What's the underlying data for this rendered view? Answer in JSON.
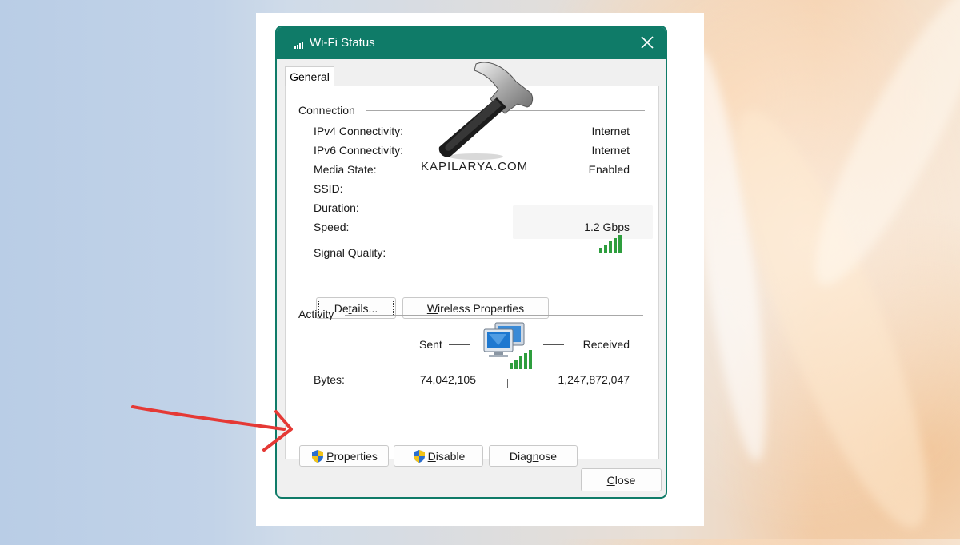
{
  "window": {
    "title": "Wi-Fi Status",
    "close_icon": "close-icon"
  },
  "tabs": [
    {
      "label": "General",
      "selected": true
    }
  ],
  "connection": {
    "heading": "Connection",
    "rows": [
      {
        "label": "IPv4 Connectivity:",
        "value": "Internet"
      },
      {
        "label": "IPv6 Connectivity:",
        "value": "Internet"
      },
      {
        "label": "Media State:",
        "value": "Enabled"
      },
      {
        "label": "SSID:",
        "value": ""
      },
      {
        "label": "Duration:",
        "value": ""
      },
      {
        "label": "Speed:",
        "value": "1.2 Gbps"
      }
    ],
    "signal_label": "Signal Quality:",
    "signal_bars_filled": 5,
    "signal_bars_total": 5,
    "details_button": {
      "prefix": "De",
      "accel": "t",
      "suffix": "ails..."
    },
    "wireless_properties_button": {
      "prefix": "",
      "accel": "W",
      "suffix": "ireless Properties"
    }
  },
  "activity": {
    "heading": "Activity",
    "sent_label": "Sent",
    "received_label": "Received",
    "bytes_label": "Bytes:",
    "bytes_sent": "74,042,105",
    "bytes_received": "1,247,872,047",
    "network_icon": "network-computers-icon"
  },
  "actions": {
    "properties": {
      "prefix": "",
      "accel": "P",
      "suffix": "roperties",
      "icon": "uac-shield-icon"
    },
    "disable": {
      "prefix": "",
      "accel": "D",
      "suffix": "isable",
      "icon": "uac-shield-icon"
    },
    "diagnose": {
      "prefix": "Diag",
      "accel": "n",
      "suffix": "ose"
    }
  },
  "footer": {
    "close": {
      "prefix": "",
      "accel": "C",
      "suffix": "lose"
    }
  },
  "watermark": {
    "text": "KAPILARYA.COM",
    "icon": "hammer-icon"
  },
  "annotation": {
    "arrow_icon": "red-arrow-icon",
    "color": "#e53935"
  },
  "colors": {
    "title_bar": "#0f7b68",
    "signal_green": "#2e9e3e"
  }
}
